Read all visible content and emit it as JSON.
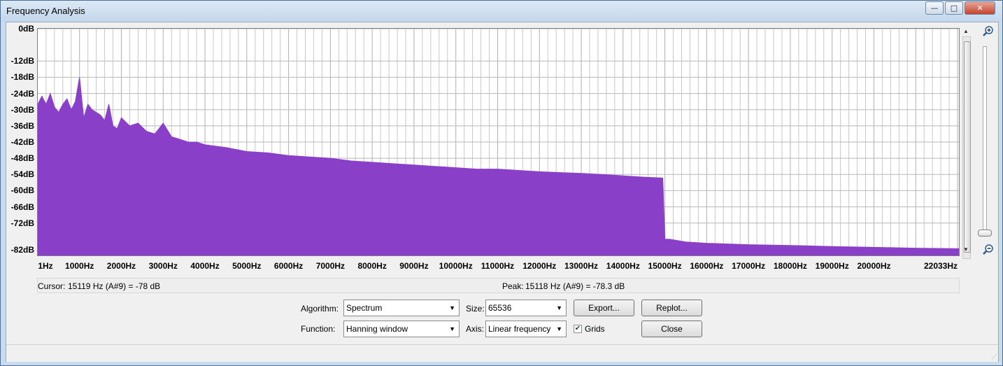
{
  "window": {
    "title": "Frequency Analysis",
    "controls": {
      "minimize": "—",
      "maximize": "□",
      "close": "✕"
    }
  },
  "chart_data": {
    "type": "area",
    "title": "",
    "xlabel": "",
    "ylabel": "",
    "color": "#8a3fc9",
    "grid": true,
    "xlim": [
      1,
      22033
    ],
    "ylim": [
      -84,
      0
    ],
    "x_ticks": [
      "1Hz",
      "1000Hz",
      "2000Hz",
      "3000Hz",
      "4000Hz",
      "5000Hz",
      "6000Hz",
      "7000Hz",
      "8000Hz",
      "9000Hz",
      "10000Hz",
      "11000Hz",
      "12000Hz",
      "13000Hz",
      "14000Hz",
      "15000Hz",
      "16000Hz",
      "17000Hz",
      "18000Hz",
      "19000Hz",
      "20000Hz",
      "22033Hz"
    ],
    "x_tick_values": [
      1,
      1000,
      2000,
      3000,
      4000,
      5000,
      6000,
      7000,
      8000,
      9000,
      10000,
      11000,
      12000,
      13000,
      14000,
      15000,
      16000,
      17000,
      18000,
      19000,
      20000,
      22033
    ],
    "y_ticks": [
      "0dB",
      "-12dB",
      "-18dB",
      "-24dB",
      "-30dB",
      "-36dB",
      "-42dB",
      "-48dB",
      "-54dB",
      "-60dB",
      "-66dB",
      "-72dB",
      "-82dB"
    ],
    "y_tick_values": [
      0,
      -12,
      -18,
      -24,
      -30,
      -36,
      -42,
      -48,
      -54,
      -60,
      -66,
      -72,
      -82
    ],
    "series": [
      {
        "x": [
          1,
          100,
          200,
          300,
          400,
          500,
          600,
          700,
          800,
          900,
          1000,
          1100,
          1200,
          1300,
          1400,
          1500,
          1600,
          1700,
          1800,
          1900,
          2000,
          2200,
          2400,
          2600,
          2800,
          3000,
          3200,
          3400,
          3600,
          3800,
          4000,
          4500,
          5000,
          5500,
          6000,
          6500,
          7000,
          7500,
          8000,
          8500,
          9000,
          9500,
          10000,
          10500,
          11000,
          11500,
          12000,
          12500,
          13000,
          13500,
          14000,
          14500,
          14950,
          15000,
          15119,
          15500,
          16000,
          17000,
          18000,
          19000,
          20000,
          21000,
          22033
        ],
        "y": [
          -28,
          -25,
          -28,
          -24,
          -29,
          -31,
          -28,
          -26,
          -30,
          -27,
          -18,
          -33,
          -28,
          -30,
          -31,
          -32,
          -34,
          -28,
          -36,
          -37,
          -33,
          -36,
          -35,
          -38,
          -39,
          -35,
          -40,
          -41,
          -42,
          -42,
          -43,
          -44,
          -45.5,
          -46,
          -47,
          -47.5,
          -48,
          -49,
          -49.5,
          -50,
          -50.5,
          -51,
          -51.5,
          -52,
          -52,
          -52.5,
          -53,
          -53.3,
          -53.6,
          -54,
          -54.5,
          -55,
          -55.3,
          -78,
          -78,
          -79,
          -79.5,
          -80,
          -80.3,
          -80.7,
          -81,
          -81.3,
          -81.5
        ]
      }
    ]
  },
  "status": {
    "cursor_label": "Cursor:",
    "cursor_value": "15119 Hz (A#9) = -78 dB",
    "peak_label": "Peak:",
    "peak_value": "15118 Hz (A#9) = -78.3 dB"
  },
  "controls": {
    "algorithm_label": "Algorithm:",
    "algorithm_value": "Spectrum",
    "function_label": "Function:",
    "function_value": "Hanning window",
    "size_label": "Size:",
    "size_value": "65536",
    "axis_label": "Axis:",
    "axis_value": "Linear frequency",
    "grids_label": "Grids",
    "grids_checked": true,
    "export_label": "Export...",
    "replot_label": "Replot...",
    "close_label": "Close"
  },
  "icons": {
    "zoom_in": "zoom-in-icon",
    "zoom_out": "zoom-out-icon"
  }
}
